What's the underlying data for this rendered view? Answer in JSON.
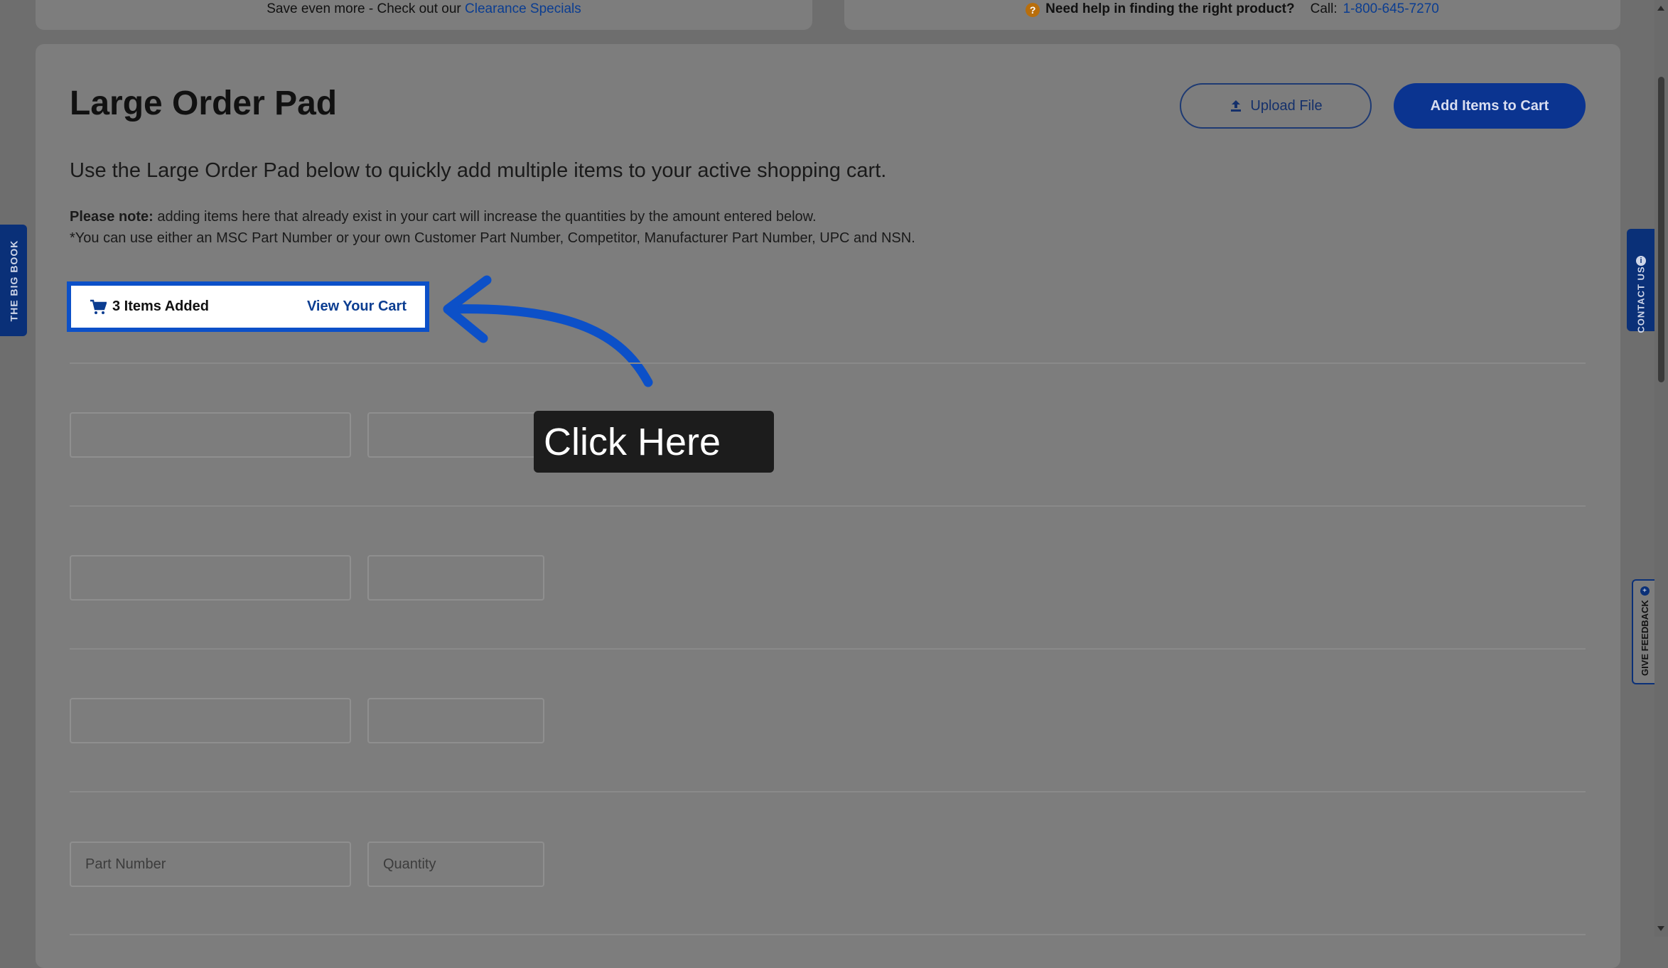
{
  "banner": {
    "save_text": "Save even more - Check out our",
    "clearance_link": "Clearance Specials",
    "help_icon": "?",
    "help_text": "Need help in finding the right product?",
    "call_label": "Call:",
    "phone": "1-800-645-7270"
  },
  "page": {
    "title": "Large Order Pad",
    "upload_label": "Upload File",
    "add_label": "Add Items to Cart",
    "intro": "Use the Large Order Pad below to quickly add multiple items to your active shopping cart.",
    "note_bold": "Please note:",
    "note_text": "adding items here that already exist in your cart will increase the quantities by the amount entered below.",
    "note_line2": "*You can use either an MSC Part Number or your own Customer Part Number, Competitor, Manufacturer Part Number, UPC and NSN."
  },
  "cart": {
    "count_text": "3 Items Added",
    "view_link": "View Your Cart"
  },
  "rows": [
    {
      "part_value": "",
      "qty_value": "",
      "part_placeholder": "",
      "qty_placeholder": ""
    },
    {
      "part_value": "",
      "qty_value": "",
      "part_placeholder": "",
      "qty_placeholder": ""
    },
    {
      "part_value": "",
      "qty_value": "",
      "part_placeholder": "",
      "qty_placeholder": ""
    },
    {
      "part_value": "",
      "qty_value": "",
      "part_placeholder": "Part Number",
      "qty_placeholder": "Quantity"
    }
  ],
  "tooltip": {
    "text": "Click Here"
  },
  "side_tabs": {
    "big_book": "THE BIG BOOK",
    "contact": "CONTACT US",
    "contact_icon": "i",
    "feedback": "GIVE FEEDBACK",
    "feedback_icon": "+"
  },
  "colors": {
    "primary": "#0b3490",
    "highlight": "#0c50c8",
    "overlay": "#7d7d7d",
    "tooltip_bg": "#1c1c1c"
  }
}
